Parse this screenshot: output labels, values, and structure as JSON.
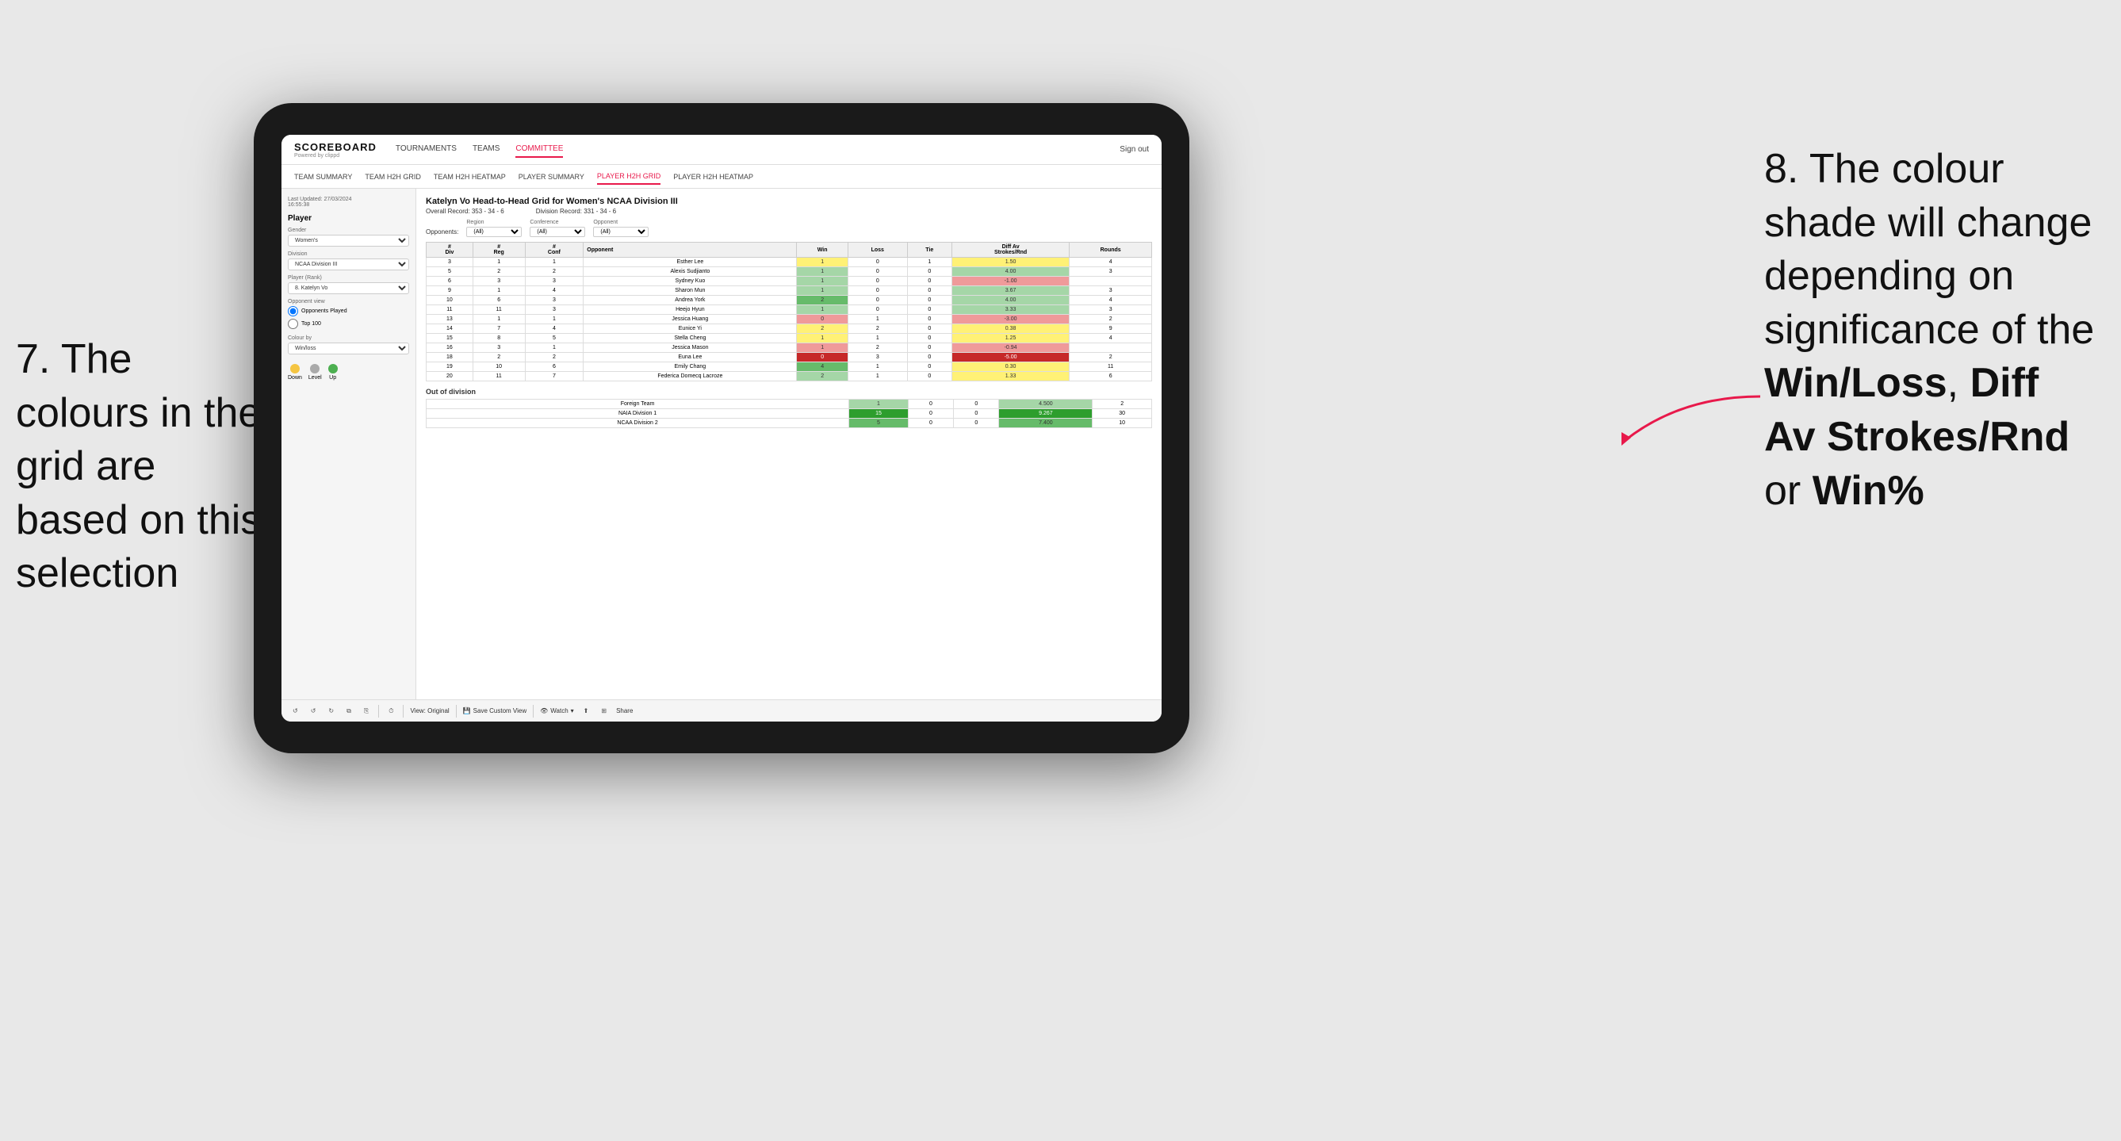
{
  "annotations": {
    "left_title": "7. The colours in the grid are based on this selection",
    "right_title": "8. The colour shade will change depending on significance of the ",
    "right_bold1": "Win/Loss",
    "right_sep1": ", ",
    "right_bold2": "Diff Av Strokes/Rnd",
    "right_sep2": " or ",
    "right_bold3": "Win%"
  },
  "nav": {
    "logo": "SCOREBOARD",
    "logo_sub": "Powered by clippd",
    "links": [
      "TOURNAMENTS",
      "TEAMS",
      "COMMITTEE"
    ],
    "active_link": "COMMITTEE",
    "right_sign_in": "Sign out"
  },
  "sub_nav": {
    "links": [
      "TEAM SUMMARY",
      "TEAM H2H GRID",
      "TEAM H2H HEATMAP",
      "PLAYER SUMMARY",
      "PLAYER H2H GRID",
      "PLAYER H2H HEATMAP"
    ],
    "active": "PLAYER H2H GRID"
  },
  "sidebar": {
    "last_updated": "Last Updated: 27/03/2024",
    "last_updated_time": "16:55:38",
    "player_section": "Player",
    "gender_label": "Gender",
    "gender_value": "Women's",
    "division_label": "Division",
    "division_value": "NCAA Division III",
    "player_rank_label": "Player (Rank)",
    "player_rank_value": "8. Katelyn Vo",
    "opponent_view_label": "Opponent view",
    "opponent_played": "Opponents Played",
    "opponent_top100": "Top 100",
    "colour_by_label": "Colour by",
    "colour_by_value": "Win/loss",
    "legend_down": "Down",
    "legend_level": "Level",
    "legend_up": "Up"
  },
  "grid": {
    "title": "Katelyn Vo Head-to-Head Grid for Women's NCAA Division III",
    "overall_record_label": "Overall Record:",
    "overall_record_value": "353 - 34 - 6",
    "division_record_label": "Division Record:",
    "division_record_value": "331 - 34 - 6",
    "opponents_label": "Opponents:",
    "region_label": "Region",
    "region_value": "(All)",
    "conference_label": "Conference",
    "conference_value": "(All)",
    "opponent_label": "Opponent",
    "opponent_value": "(All)",
    "col_headers": [
      "#\nDiv",
      "#\nReg",
      "#\nConf",
      "Opponent",
      "Win",
      "Loss",
      "Tie",
      "Diff Av\nStrokes/Rnd",
      "Rounds"
    ],
    "rows": [
      {
        "div": "3",
        "reg": "1",
        "conf": "1",
        "opponent": "Esther Lee",
        "win": "1",
        "loss": "0",
        "tie": "1",
        "diff": "1.50",
        "rounds": "4",
        "win_color": "bg-yellow",
        "diff_color": "bg-yellow"
      },
      {
        "div": "5",
        "reg": "2",
        "conf": "2",
        "opponent": "Alexis Sudjianto",
        "win": "1",
        "loss": "0",
        "tie": "0",
        "diff": "4.00",
        "rounds": "3",
        "win_color": "bg-green-light",
        "diff_color": "bg-green-light"
      },
      {
        "div": "6",
        "reg": "3",
        "conf": "3",
        "opponent": "Sydney Kuo",
        "win": "1",
        "loss": "0",
        "tie": "0",
        "diff": "-1.00",
        "rounds": "",
        "win_color": "bg-green-light",
        "diff_color": "bg-red-light"
      },
      {
        "div": "9",
        "reg": "1",
        "conf": "4",
        "opponent": "Sharon Mun",
        "win": "1",
        "loss": "0",
        "tie": "0",
        "diff": "3.67",
        "rounds": "3",
        "win_color": "bg-green-light",
        "diff_color": "bg-green-light"
      },
      {
        "div": "10",
        "reg": "6",
        "conf": "3",
        "opponent": "Andrea York",
        "win": "2",
        "loss": "0",
        "tie": "0",
        "diff": "4.00",
        "rounds": "4",
        "win_color": "bg-green-med",
        "diff_color": "bg-green-light"
      },
      {
        "div": "11",
        "reg": "11",
        "conf": "3",
        "opponent": "Heejo Hyun",
        "win": "1",
        "loss": "0",
        "tie": "0",
        "diff": "3.33",
        "rounds": "3",
        "win_color": "bg-green-light",
        "diff_color": "bg-green-light"
      },
      {
        "div": "13",
        "reg": "1",
        "conf": "1",
        "opponent": "Jessica Huang",
        "win": "0",
        "loss": "1",
        "tie": "0",
        "diff": "-3.00",
        "rounds": "2",
        "win_color": "bg-red-light",
        "diff_color": "bg-red-light"
      },
      {
        "div": "14",
        "reg": "7",
        "conf": "4",
        "opponent": "Eunice Yi",
        "win": "2",
        "loss": "2",
        "tie": "0",
        "diff": "0.38",
        "rounds": "9",
        "win_color": "bg-yellow",
        "diff_color": "bg-yellow"
      },
      {
        "div": "15",
        "reg": "8",
        "conf": "5",
        "opponent": "Stella Cheng",
        "win": "1",
        "loss": "1",
        "tie": "0",
        "diff": "1.25",
        "rounds": "4",
        "win_color": "bg-yellow",
        "diff_color": "bg-yellow"
      },
      {
        "div": "16",
        "reg": "3",
        "conf": "1",
        "opponent": "Jessica Mason",
        "win": "1",
        "loss": "2",
        "tie": "0",
        "diff": "-0.94",
        "rounds": "",
        "win_color": "bg-red-light",
        "diff_color": "bg-red-light"
      },
      {
        "div": "18",
        "reg": "2",
        "conf": "2",
        "opponent": "Euna Lee",
        "win": "0",
        "loss": "3",
        "tie": "0",
        "diff": "-5.00",
        "rounds": "2",
        "win_color": "bg-red-strong",
        "diff_color": "bg-red-strong"
      },
      {
        "div": "19",
        "reg": "10",
        "conf": "6",
        "opponent": "Emily Chang",
        "win": "4",
        "loss": "1",
        "tie": "0",
        "diff": "0.30",
        "rounds": "11",
        "win_color": "bg-green-med",
        "diff_color": "bg-yellow"
      },
      {
        "div": "20",
        "reg": "11",
        "conf": "7",
        "opponent": "Federica Domecq Lacroze",
        "win": "2",
        "loss": "1",
        "tie": "0",
        "diff": "1.33",
        "rounds": "6",
        "win_color": "bg-green-light",
        "diff_color": "bg-yellow"
      }
    ],
    "ood_title": "Out of division",
    "ood_rows": [
      {
        "opponent": "Foreign Team",
        "win": "1",
        "loss": "0",
        "tie": "0",
        "diff": "4.500",
        "rounds": "2",
        "win_color": "bg-green-light",
        "diff_color": "bg-green-light"
      },
      {
        "opponent": "NAIA Division 1",
        "win": "15",
        "loss": "0",
        "tie": "0",
        "diff": "9.267",
        "rounds": "30",
        "win_color": "bg-green-strong",
        "diff_color": "bg-green-strong"
      },
      {
        "opponent": "NCAA Division 2",
        "win": "5",
        "loss": "0",
        "tie": "0",
        "diff": "7.400",
        "rounds": "10",
        "win_color": "bg-green-med",
        "diff_color": "bg-green-med"
      }
    ]
  },
  "toolbar": {
    "view_original": "View: Original",
    "save_custom": "Save Custom View",
    "watch": "Watch",
    "share": "Share"
  }
}
